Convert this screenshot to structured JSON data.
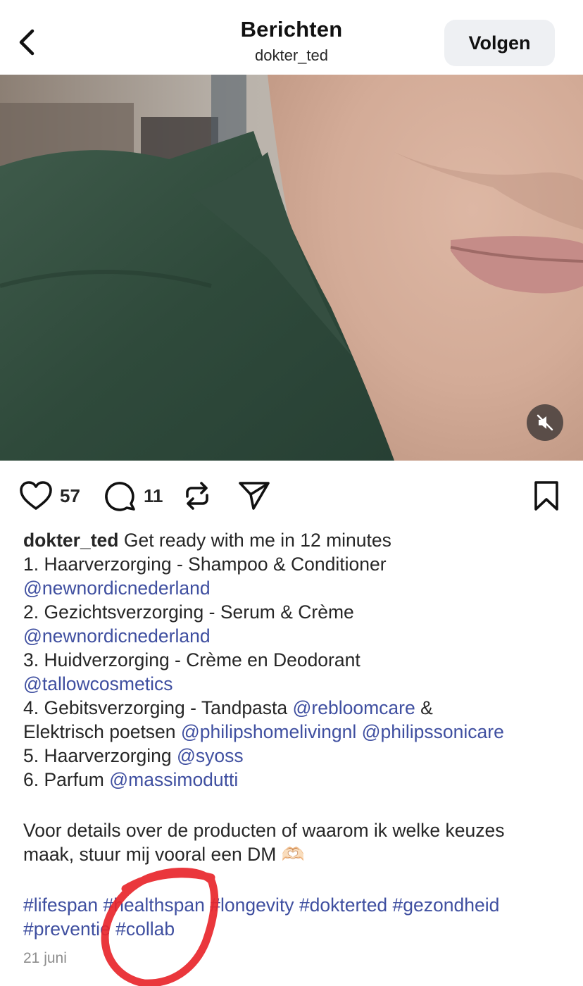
{
  "header": {
    "title": "Berichten",
    "subtitle": "dokter_ted",
    "follow_label": "Volgen"
  },
  "icons": {
    "back": "chevron-left-icon",
    "mute": "speaker-muted-icon",
    "like": "heart-icon",
    "comment": "speech-bubble-icon",
    "repost": "repost-icon",
    "share": "paper-plane-icon",
    "save": "bookmark-icon"
  },
  "actions": {
    "likes": "57",
    "comments": "11"
  },
  "caption": {
    "username": "dokter_ted",
    "intro": "Get ready with me in 12 minutes",
    "item1_text": "1. Haarverzorging - Shampoo & Conditioner",
    "item1_mention": "@newnordicnederland",
    "item2_text": "2. Gezichtsverzorging - Serum & Crème",
    "item2_mention": "@newnordicnederland",
    "item3_text": "3. Huidverzorging - Crème en Deodorant",
    "item3_mention": "@tallowcosmetics",
    "item4_text": "4. Gebitsverzorging - Tandpasta",
    "item4_mention": "@rebloomcare",
    "item4_amp": "&",
    "item4b_text": "Elektrisch poetsen",
    "item4b_mention1": "@philipshomelivingnl",
    "item4b_mention2": "@philipssonicare",
    "item5_text": "5. Haarverzorging",
    "item5_mention": "@syoss",
    "item6_text": "6. Parfum",
    "item6_mention": "@massimodutti",
    "outro_line1": "Voor details over de producten of waarom ik welke keuzes",
    "outro_line2": "maak, stuur mij vooral een DM 🫶🏻",
    "hashtags_line1": [
      "#lifespan",
      "#healthspan",
      "#longevity",
      "#dokterted",
      "#gezondheid"
    ],
    "hashtags_line2": [
      "#preventie",
      "#collab"
    ]
  },
  "date": "21 juni",
  "colors": {
    "link": "#3f4fa0",
    "follow_bg": "#eef0f3",
    "annotation": "#e8262b"
  }
}
